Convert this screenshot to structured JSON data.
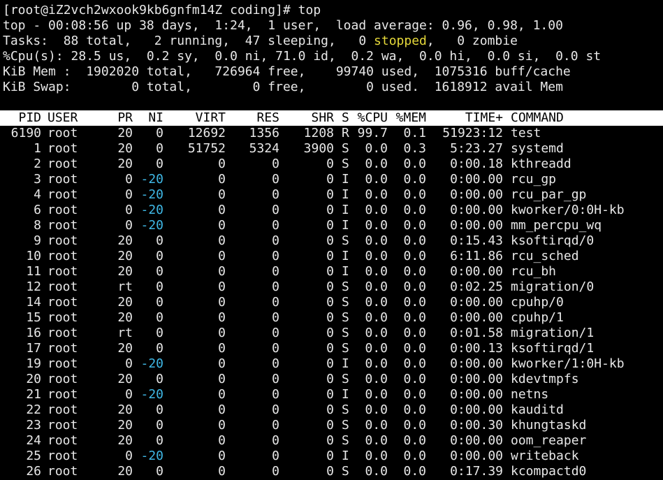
{
  "prompt": "[root@iZ2vch2wxook9kb6gnfm14Z coding]# top",
  "summary": {
    "uptime_line": "top - 00:08:56 up 38 days,  1:24,  1 user,  load average: 0.96, 0.98, 1.00",
    "tasks_prefix": "Tasks:  88 total,   2 running,  47 sleeping,   0 ",
    "tasks_stopped": "stopped",
    "tasks_suffix": ",   0 zombie",
    "cpu_line": "%Cpu(s): 28.5 us,  0.2 sy,  0.0 ni, 71.0 id,  0.2 wa,  0.0 hi,  0.0 si,  0.0 st",
    "mem_line": "KiB Mem :  1902020 total,   726964 free,    99740 used,  1075316 buff/cache",
    "swap_line": "KiB Swap:        0 total,        0 free,        0 used.  1618912 avail Mem"
  },
  "columns": {
    "pid": "PID",
    "user": "USER",
    "pr": "PR",
    "ni": "NI",
    "virt": "VIRT",
    "res": "RES",
    "shr": "SHR",
    "s": "S",
    "cpu": "%CPU",
    "mem": "%MEM",
    "time": "TIME+",
    "command": "COMMAND"
  },
  "processes": [
    {
      "pid": "6190",
      "user": "root",
      "pr": "20",
      "ni": "0",
      "virt": "12692",
      "res": "1356",
      "shr": "1208",
      "s": "R",
      "cpu": "99.7",
      "mem": "0.1",
      "time": "51923:12",
      "command": "test"
    },
    {
      "pid": "1",
      "user": "root",
      "pr": "20",
      "ni": "0",
      "virt": "51752",
      "res": "5324",
      "shr": "3900",
      "s": "S",
      "cpu": "0.0",
      "mem": "0.3",
      "time": "5:23.27",
      "command": "systemd"
    },
    {
      "pid": "2",
      "user": "root",
      "pr": "20",
      "ni": "0",
      "virt": "0",
      "res": "0",
      "shr": "0",
      "s": "S",
      "cpu": "0.0",
      "mem": "0.0",
      "time": "0:00.18",
      "command": "kthreadd"
    },
    {
      "pid": "3",
      "user": "root",
      "pr": "0",
      "ni": "-20",
      "virt": "0",
      "res": "0",
      "shr": "0",
      "s": "I",
      "cpu": "0.0",
      "mem": "0.0",
      "time": "0:00.00",
      "command": "rcu_gp"
    },
    {
      "pid": "4",
      "user": "root",
      "pr": "0",
      "ni": "-20",
      "virt": "0",
      "res": "0",
      "shr": "0",
      "s": "I",
      "cpu": "0.0",
      "mem": "0.0",
      "time": "0:00.00",
      "command": "rcu_par_gp"
    },
    {
      "pid": "6",
      "user": "root",
      "pr": "0",
      "ni": "-20",
      "virt": "0",
      "res": "0",
      "shr": "0",
      "s": "I",
      "cpu": "0.0",
      "mem": "0.0",
      "time": "0:00.00",
      "command": "kworker/0:0H-kb"
    },
    {
      "pid": "8",
      "user": "root",
      "pr": "0",
      "ni": "-20",
      "virt": "0",
      "res": "0",
      "shr": "0",
      "s": "I",
      "cpu": "0.0",
      "mem": "0.0",
      "time": "0:00.00",
      "command": "mm_percpu_wq"
    },
    {
      "pid": "9",
      "user": "root",
      "pr": "20",
      "ni": "0",
      "virt": "0",
      "res": "0",
      "shr": "0",
      "s": "S",
      "cpu": "0.0",
      "mem": "0.0",
      "time": "0:15.43",
      "command": "ksoftirqd/0"
    },
    {
      "pid": "10",
      "user": "root",
      "pr": "20",
      "ni": "0",
      "virt": "0",
      "res": "0",
      "shr": "0",
      "s": "I",
      "cpu": "0.0",
      "mem": "0.0",
      "time": "6:11.86",
      "command": "rcu_sched"
    },
    {
      "pid": "11",
      "user": "root",
      "pr": "20",
      "ni": "0",
      "virt": "0",
      "res": "0",
      "shr": "0",
      "s": "I",
      "cpu": "0.0",
      "mem": "0.0",
      "time": "0:00.00",
      "command": "rcu_bh"
    },
    {
      "pid": "12",
      "user": "root",
      "pr": "rt",
      "ni": "0",
      "virt": "0",
      "res": "0",
      "shr": "0",
      "s": "S",
      "cpu": "0.0",
      "mem": "0.0",
      "time": "0:02.25",
      "command": "migration/0"
    },
    {
      "pid": "14",
      "user": "root",
      "pr": "20",
      "ni": "0",
      "virt": "0",
      "res": "0",
      "shr": "0",
      "s": "S",
      "cpu": "0.0",
      "mem": "0.0",
      "time": "0:00.00",
      "command": "cpuhp/0"
    },
    {
      "pid": "15",
      "user": "root",
      "pr": "20",
      "ni": "0",
      "virt": "0",
      "res": "0",
      "shr": "0",
      "s": "S",
      "cpu": "0.0",
      "mem": "0.0",
      "time": "0:00.00",
      "command": "cpuhp/1"
    },
    {
      "pid": "16",
      "user": "root",
      "pr": "rt",
      "ni": "0",
      "virt": "0",
      "res": "0",
      "shr": "0",
      "s": "S",
      "cpu": "0.0",
      "mem": "0.0",
      "time": "0:01.58",
      "command": "migration/1"
    },
    {
      "pid": "17",
      "user": "root",
      "pr": "20",
      "ni": "0",
      "virt": "0",
      "res": "0",
      "shr": "0",
      "s": "S",
      "cpu": "0.0",
      "mem": "0.0",
      "time": "0:00.13",
      "command": "ksoftirqd/1"
    },
    {
      "pid": "19",
      "user": "root",
      "pr": "0",
      "ni": "-20",
      "virt": "0",
      "res": "0",
      "shr": "0",
      "s": "I",
      "cpu": "0.0",
      "mem": "0.0",
      "time": "0:00.00",
      "command": "kworker/1:0H-kb"
    },
    {
      "pid": "20",
      "user": "root",
      "pr": "20",
      "ni": "0",
      "virt": "0",
      "res": "0",
      "shr": "0",
      "s": "S",
      "cpu": "0.0",
      "mem": "0.0",
      "time": "0:00.00",
      "command": "kdevtmpfs"
    },
    {
      "pid": "21",
      "user": "root",
      "pr": "0",
      "ni": "-20",
      "virt": "0",
      "res": "0",
      "shr": "0",
      "s": "I",
      "cpu": "0.0",
      "mem": "0.0",
      "time": "0:00.00",
      "command": "netns"
    },
    {
      "pid": "22",
      "user": "root",
      "pr": "20",
      "ni": "0",
      "virt": "0",
      "res": "0",
      "shr": "0",
      "s": "S",
      "cpu": "0.0",
      "mem": "0.0",
      "time": "0:00.00",
      "command": "kauditd"
    },
    {
      "pid": "23",
      "user": "root",
      "pr": "20",
      "ni": "0",
      "virt": "0",
      "res": "0",
      "shr": "0",
      "s": "S",
      "cpu": "0.0",
      "mem": "0.0",
      "time": "0:00.30",
      "command": "khungtaskd"
    },
    {
      "pid": "24",
      "user": "root",
      "pr": "20",
      "ni": "0",
      "virt": "0",
      "res": "0",
      "shr": "0",
      "s": "S",
      "cpu": "0.0",
      "mem": "0.0",
      "time": "0:00.00",
      "command": "oom_reaper"
    },
    {
      "pid": "25",
      "user": "root",
      "pr": "0",
      "ni": "-20",
      "virt": "0",
      "res": "0",
      "shr": "0",
      "s": "I",
      "cpu": "0.0",
      "mem": "0.0",
      "time": "0:00.00",
      "command": "writeback"
    },
    {
      "pid": "26",
      "user": "root",
      "pr": "20",
      "ni": "0",
      "virt": "0",
      "res": "0",
      "shr": "0",
      "s": "S",
      "cpu": "0.0",
      "mem": "0.0",
      "time": "0:17.39",
      "command": "kcompactd0"
    }
  ],
  "colors": {
    "background": "#000000",
    "foreground": "#e8e8e8",
    "stopped": "#e6d93a",
    "negative_nice": "#3fb8e6",
    "header_bg": "#ffffff",
    "header_fg": "#000000"
  }
}
